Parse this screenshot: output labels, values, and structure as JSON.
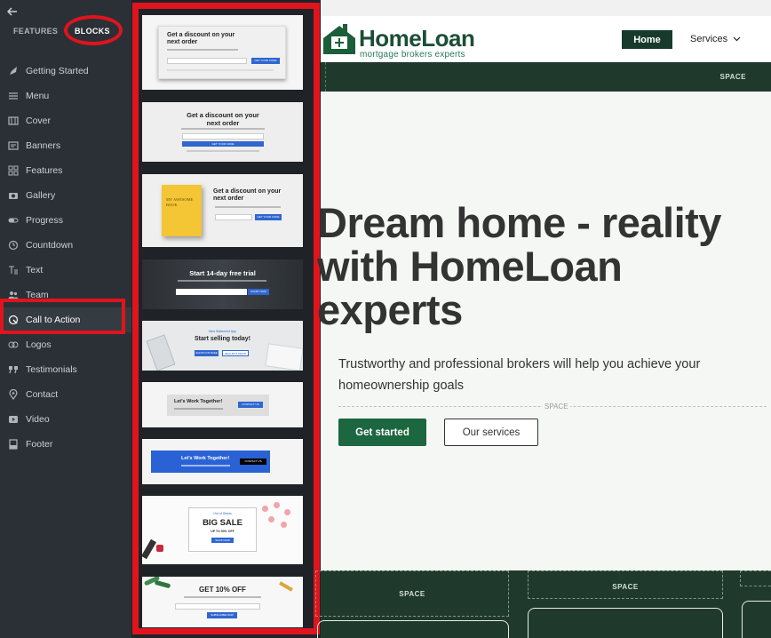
{
  "sidebar": {
    "tabs": {
      "features": "FEATURES",
      "blocks": "BLOCKS"
    },
    "items": [
      {
        "label": "Getting Started",
        "icon": "rocket-icon"
      },
      {
        "label": "Menu",
        "icon": "menu-icon"
      },
      {
        "label": "Cover",
        "icon": "cover-icon"
      },
      {
        "label": "Banners",
        "icon": "banner-icon"
      },
      {
        "label": "Features",
        "icon": "features-grid-icon"
      },
      {
        "label": "Gallery",
        "icon": "camera-icon"
      },
      {
        "label": "Progress",
        "icon": "progress-icon"
      },
      {
        "label": "Countdown",
        "icon": "clock-icon"
      },
      {
        "label": "Text",
        "icon": "text-icon"
      },
      {
        "label": "Team",
        "icon": "team-icon"
      },
      {
        "label": "Call to Action",
        "icon": "cta-icon",
        "active": true
      },
      {
        "label": "Logos",
        "icon": "logos-icon"
      },
      {
        "label": "Testimonials",
        "icon": "quote-icon"
      },
      {
        "label": "Contact",
        "icon": "location-pin-icon"
      },
      {
        "label": "Video",
        "icon": "video-icon"
      },
      {
        "label": "Footer",
        "icon": "footer-icon"
      }
    ]
  },
  "thumbs": {
    "t1": {
      "title": "Get a discount on your next order",
      "button": "GET YOUR CODE"
    },
    "t2": {
      "title": "Get a discount on your next order",
      "button": "GET YOUR CODE"
    },
    "t3": {
      "title": "Get a discount on your next order",
      "book": "MY AWESOME BOOK",
      "button": "GET YOUR CODE"
    },
    "t4": {
      "title": "Start 14-day free trial",
      "button": "START NOW"
    },
    "t5": {
      "kicker": "New Statement App",
      "title": "Start selling today!",
      "button1": "SHOP FOR FREE",
      "button2": "REQUEST DEMO"
    },
    "t6": {
      "title": "Let's Work Together!",
      "button": "CONTACT US"
    },
    "t7": {
      "title": "Let's Work Together!",
      "button": "CONTACT US"
    },
    "t8": {
      "kicker": "Out of Stress",
      "title": "BIG SALE",
      "sub": "UP TO 50% OFF",
      "button": "SHOP NOW"
    },
    "t9": {
      "title": "GET 10% OFF",
      "button": "SUBSCRIBE NOW"
    }
  },
  "site": {
    "logo_title": "HomeLoan",
    "logo_sub": "mortgage brokers  experts",
    "nav_home": "Home",
    "nav_services": "Services",
    "space_label": "SPACE",
    "hero_title": "Dream home - reality with HomeLoan experts",
    "hero_sub": "Trustworthy and professional brokers will help you achieve your homeownership goals",
    "btn_primary": "Get started",
    "btn_outline": "Our services"
  },
  "colors": {
    "accent_red": "#e0141d",
    "brand_green": "#1c6640",
    "dark_green": "#1f3a2d"
  }
}
